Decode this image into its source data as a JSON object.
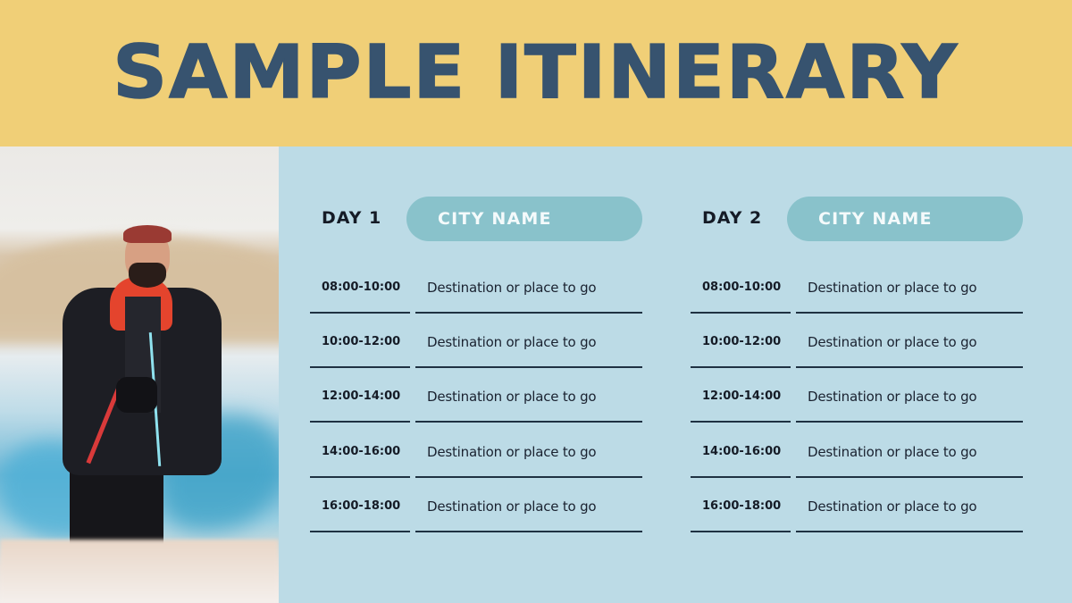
{
  "header": {
    "title": "SAMPLE ITINERARY"
  },
  "colors": {
    "header_bg": "#f0cf77",
    "title": "#37536f",
    "panel_bg": "#bcdbe6",
    "pill": "#89c2cb"
  },
  "photo": {
    "description": "Smiling bearded man in black jacket with red hood standing on glacier ice"
  },
  "days": [
    {
      "label": "DAY 1",
      "city": "CITY NAME",
      "slots": [
        {
          "time": "08:00-10:00",
          "destination": "Destination or place to go"
        },
        {
          "time": "10:00-12:00",
          "destination": "Destination or place to go"
        },
        {
          "time": "12:00-14:00",
          "destination": "Destination or place to go"
        },
        {
          "time": "14:00-16:00",
          "destination": "Destination or place to go"
        },
        {
          "time": "16:00-18:00",
          "destination": "Destination or place to go"
        }
      ]
    },
    {
      "label": "DAY 2",
      "city": "CITY NAME",
      "slots": [
        {
          "time": "08:00-10:00",
          "destination": "Destination or place to go"
        },
        {
          "time": "10:00-12:00",
          "destination": "Destination or place to go"
        },
        {
          "time": "12:00-14:00",
          "destination": "Destination or place to go"
        },
        {
          "time": "14:00-16:00",
          "destination": "Destination or place to go"
        },
        {
          "time": "16:00-18:00",
          "destination": "Destination or place to go"
        }
      ]
    }
  ]
}
